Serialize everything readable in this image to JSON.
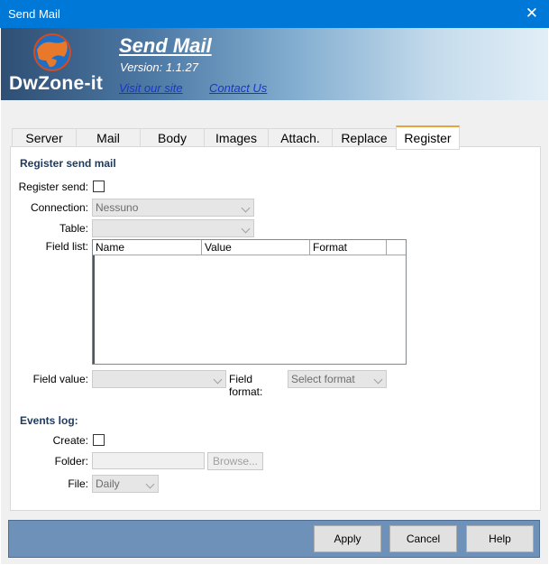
{
  "window": {
    "title": "Send Mail",
    "close_glyph": "✕"
  },
  "banner": {
    "logo_text": "DwZone-it",
    "app_title": "Send Mail",
    "version": "Version: 1.1.27",
    "visit_link": "Visit our site",
    "contact_link": "Contact Us"
  },
  "tabs": [
    {
      "label": "Server"
    },
    {
      "label": "Mail"
    },
    {
      "label": "Body"
    },
    {
      "label": "Images"
    },
    {
      "label": "Attach."
    },
    {
      "label": "Replace"
    },
    {
      "label": "Register",
      "active": true
    }
  ],
  "register": {
    "section_title": "Register send mail",
    "register_send_label": "Register send:",
    "register_send_checked": false,
    "connection_label": "Connection:",
    "connection_value": "Nessuno",
    "table_label": "Table:",
    "table_value": "",
    "field_list_label": "Field list:",
    "columns": [
      "Name",
      "Value",
      "Format"
    ],
    "rows": [],
    "field_value_label": "Field value:",
    "field_value_value": "",
    "field_format_label": "Field format:",
    "field_format_value": "Select format"
  },
  "events": {
    "section_title": "Events log:",
    "create_label": "Create:",
    "create_checked": false,
    "folder_label": "Folder:",
    "folder_value": "",
    "browse_label": "Browse...",
    "file_label": "File:",
    "file_value": "Daily"
  },
  "footer": {
    "apply": "Apply",
    "cancel": "Cancel",
    "help": "Help"
  }
}
